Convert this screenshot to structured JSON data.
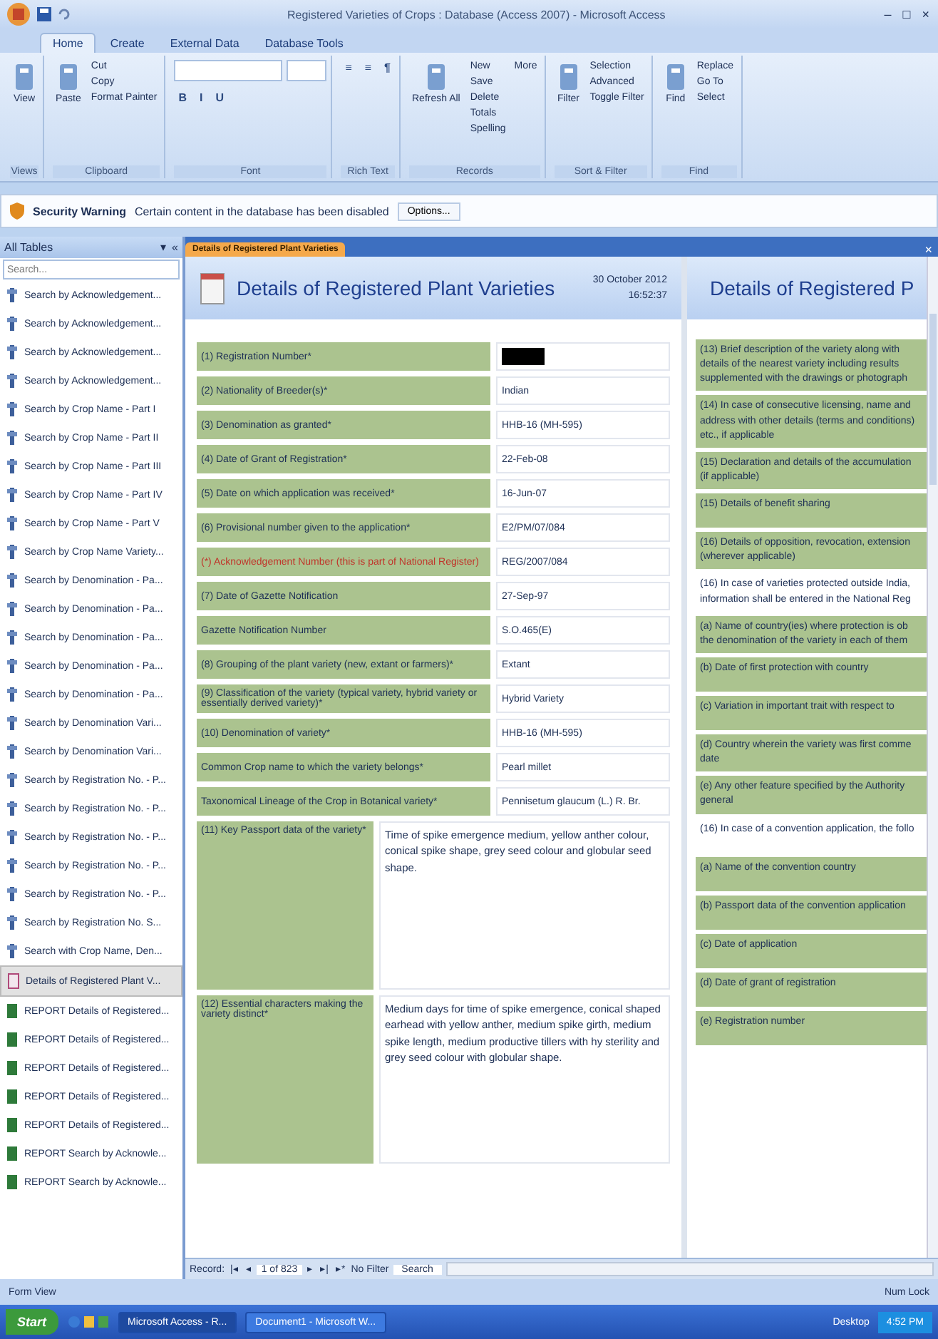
{
  "window": {
    "title": "Registered Varieties of Crops : Database (Access 2007) - Microsoft Access",
    "controls": [
      "–",
      "□",
      "×"
    ]
  },
  "ribbon": {
    "tabs": [
      {
        "label": "Home",
        "selected": true
      },
      {
        "label": "Create",
        "selected": false
      },
      {
        "label": "External Data",
        "selected": false
      },
      {
        "label": "Database Tools",
        "selected": false
      }
    ],
    "groups": [
      {
        "label": "Views",
        "kind": "large",
        "buttons": [
          "View"
        ]
      },
      {
        "label": "Clipboard",
        "kind": "mixed",
        "buttons": [
          "Paste",
          "Cut",
          "Copy",
          "Format Painter"
        ]
      },
      {
        "label": "Font",
        "kind": "font",
        "buttons": [
          "B",
          "I",
          "U"
        ]
      },
      {
        "label": "Rich Text",
        "kind": "small",
        "buttons": [
          "≡",
          "≡",
          "¶"
        ]
      },
      {
        "label": "Records",
        "kind": "mixed",
        "buttons": [
          "Refresh All",
          "New",
          "Save",
          "Delete",
          "Totals",
          "Spelling",
          "More"
        ]
      },
      {
        "label": "Sort & Filter",
        "kind": "mixed",
        "buttons": [
          "Filter",
          "Selection",
          "Advanced",
          "Toggle Filter"
        ]
      },
      {
        "label": "Find",
        "kind": "mixed",
        "buttons": [
          "Find",
          "Replace",
          "Go To",
          "Select"
        ]
      }
    ]
  },
  "security_bar": {
    "title": "Security Warning",
    "message": "Certain content in the database has been disabled",
    "button": "Options..."
  },
  "navigation": {
    "title": "All Tables",
    "controls": [
      "▾",
      "«"
    ],
    "search": {
      "placeholder": "Search..."
    },
    "items": [
      {
        "label": "Search by Acknowledgement...",
        "kind": "query",
        "selected": false
      },
      {
        "label": "Search by Acknowledgement...",
        "kind": "query",
        "selected": false
      },
      {
        "label": "Search by Acknowledgement...",
        "kind": "query",
        "selected": false
      },
      {
        "label": "Search by Acknowledgement...",
        "kind": "query",
        "selected": false
      },
      {
        "label": "Search by Crop Name - Part I",
        "kind": "query",
        "selected": false
      },
      {
        "label": "Search by Crop Name - Part II",
        "kind": "query",
        "selected": false
      },
      {
        "label": "Search by Crop Name - Part III",
        "kind": "query",
        "selected": false
      },
      {
        "label": "Search by Crop Name - Part IV",
        "kind": "query",
        "selected": false
      },
      {
        "label": "Search by Crop Name - Part V",
        "kind": "query",
        "selected": false
      },
      {
        "label": "Search by Crop Name Variety...",
        "kind": "query",
        "selected": false
      },
      {
        "label": "Search by Denomination - Pa...",
        "kind": "query",
        "selected": false
      },
      {
        "label": "Search by Denomination - Pa...",
        "kind": "query",
        "selected": false
      },
      {
        "label": "Search by Denomination - Pa...",
        "kind": "query",
        "selected": false
      },
      {
        "label": "Search by Denomination - Pa...",
        "kind": "query",
        "selected": false
      },
      {
        "label": "Search by Denomination - Pa...",
        "kind": "query",
        "selected": false
      },
      {
        "label": "Search by Denomination Vari...",
        "kind": "query",
        "selected": false
      },
      {
        "label": "Search by Denomination Vari...",
        "kind": "query",
        "selected": false
      },
      {
        "label": "Search by Registration No. - P...",
        "kind": "query",
        "selected": false
      },
      {
        "label": "Search by Registration No. - P...",
        "kind": "query",
        "selected": false
      },
      {
        "label": "Search by Registration No. - P...",
        "kind": "query",
        "selected": false
      },
      {
        "label": "Search by Registration No. - P...",
        "kind": "query",
        "selected": false
      },
      {
        "label": "Search by Registration No. - P...",
        "kind": "query",
        "selected": false
      },
      {
        "label": "Search by Registration No. S...",
        "kind": "query",
        "selected": false
      },
      {
        "label": "Search with Crop Name, Den...",
        "kind": "query",
        "selected": false
      },
      {
        "label": "Details of Registered Plant V...",
        "kind": "form",
        "selected": true
      },
      {
        "label": "REPORT Details of Registered...",
        "kind": "report",
        "selected": false
      },
      {
        "label": "REPORT Details of Registered...",
        "kind": "report",
        "selected": false
      },
      {
        "label": "REPORT Details of Registered...",
        "kind": "report",
        "selected": false
      },
      {
        "label": "REPORT Details of Registered...",
        "kind": "report",
        "selected": false
      },
      {
        "label": "REPORT Details of Registered...",
        "kind": "report",
        "selected": false
      },
      {
        "label": "REPORT Search by Acknowle...",
        "kind": "report",
        "selected": false
      },
      {
        "label": "REPORT Search by Acknowle...",
        "kind": "report",
        "selected": false
      }
    ]
  },
  "document_tab": {
    "label": "Details of Registered Plant Varieties",
    "close": "×"
  },
  "form": {
    "title": "Details of Registered Plant Varieties",
    "date": "30 October 2012",
    "time": "16:52:37",
    "rows": [
      {
        "label": "(1) Registration Number*",
        "kind": "redacted",
        "emphasis": false
      },
      {
        "label": "(2) Nationality of Breeder(s)*",
        "value": "Indian",
        "kind": "short",
        "emphasis": false
      },
      {
        "label": "(3) Denomination as granted*",
        "value": "HHB-16 (MH-595)",
        "kind": "short",
        "emphasis": false
      },
      {
        "label": "(4) Date of Grant of Registration*",
        "value": "22-Feb-08",
        "kind": "short",
        "emphasis": false
      },
      {
        "label": "(5) Date on which application was received*",
        "value": "16-Jun-07",
        "kind": "short",
        "emphasis": false
      },
      {
        "label": "(6) Provisional number given to the application*",
        "value": "E2/PM/07/084",
        "kind": "short",
        "emphasis": false
      },
      {
        "label": "(*) Acknowledgement Number (this is part of National Register)",
        "value": "REG/2007/084",
        "kind": "short",
        "emphasis": true
      },
      {
        "label": "(7) Date of Gazette Notification",
        "value": "27-Sep-97",
        "kind": "short",
        "emphasis": false
      },
      {
        "label": "Gazette Notification Number",
        "value": "S.O.465(E)",
        "kind": "short",
        "emphasis": false
      },
      {
        "label": "(8) Grouping of the plant variety (new, extant or farmers)*",
        "value": "Extant",
        "kind": "short",
        "emphasis": false
      },
      {
        "label": "(9) Classification of the variety (typical variety, hybrid variety or essentially derived variety)*",
        "value": "Hybrid Variety",
        "kind": "short",
        "emphasis": false
      },
      {
        "label": "(10) Denomination of variety*",
        "value": "HHB-16 (MH-595)",
        "kind": "short",
        "emphasis": false
      },
      {
        "label": "Common Crop name to which the variety belongs*",
        "value": "Pearl millet",
        "kind": "short",
        "emphasis": false
      },
      {
        "label": "Taxonomical Lineage of the Crop in Botanical variety*",
        "value": "Pennisetum glaucum (L.) R. Br.",
        "kind": "short",
        "emphasis": false
      },
      {
        "label": "(11) Key Passport data of the variety*",
        "value": "Time of spike emergence medium, yellow anther colour, conical spike shape, grey seed colour and globular seed shape.",
        "kind": "tall",
        "emphasis": false
      },
      {
        "label": "(12) Essential characters making the variety distinct*",
        "value": "Medium days for time of spike emergence, conical shaped earhead with yellow anther, medium spike girth, medium spike length, medium productive tillers with hy sterility and grey seed colour with globular shape.",
        "kind": "tall",
        "emphasis": false
      }
    ]
  },
  "second_page": {
    "title": "Details of Registered P",
    "items": [
      {
        "label": "(13) Brief description of the variety along with details of the nearest variety including results supplemented with the drawings or photograph",
        "kind": "field"
      },
      {
        "label": "(14) In case of consecutive licensing, name and address with other details (terms and conditions) etc., if applicable",
        "kind": "field"
      },
      {
        "label": "(15) Declaration and details of the accumulation (if applicable)",
        "kind": "field"
      },
      {
        "label": "(15) Details of benefit sharing",
        "kind": "field"
      },
      {
        "label": "(16) Details of opposition, revocation, extension (wherever applicable)",
        "kind": "field"
      },
      {
        "label": "(16) In case of varieties protected outside India, information shall be entered in the National Reg",
        "kind": "heading"
      },
      {
        "label": "(a) Name of country(ies) where protection is ob the denomination of the variety in each of them",
        "kind": "field"
      },
      {
        "label": "(b) Date of first protection with country",
        "kind": "field"
      },
      {
        "label": "(c) Variation in important trait with respect to",
        "kind": "field"
      },
      {
        "label": "(d) Country wherein the variety was first comme date",
        "kind": "field"
      },
      {
        "label": "(e) Any other feature specified by the Authority general",
        "kind": "field"
      },
      {
        "label": "(16) In case of a convention application, the follo",
        "kind": "heading"
      },
      {
        "label": "(a) Name of the convention country",
        "kind": "field"
      },
      {
        "label": "(b) Passport data of the convention application",
        "kind": "field"
      },
      {
        "label": "(c) Date of application",
        "kind": "field"
      },
      {
        "label": "(d) Date of grant of registration",
        "kind": "field"
      },
      {
        "label": "(e) Registration number",
        "kind": "field"
      }
    ]
  },
  "record_bar": {
    "label": "Record:",
    "buttons": [
      "|◂",
      "◂"
    ],
    "position": "1 of 823",
    "next": [
      "▸",
      "▸|",
      "▸*"
    ],
    "filter": "No Filter",
    "search": "Search"
  },
  "status_bar": {
    "left": "Form View",
    "right": "Num Lock"
  },
  "taskbar": {
    "start": "Start",
    "windows": [
      {
        "label": "Microsoft Access - R...",
        "selected": true
      },
      {
        "label": "Document1 - Microsoft W...",
        "selected": false
      }
    ],
    "tray": "Desktop",
    "clock": "4:52 PM"
  }
}
